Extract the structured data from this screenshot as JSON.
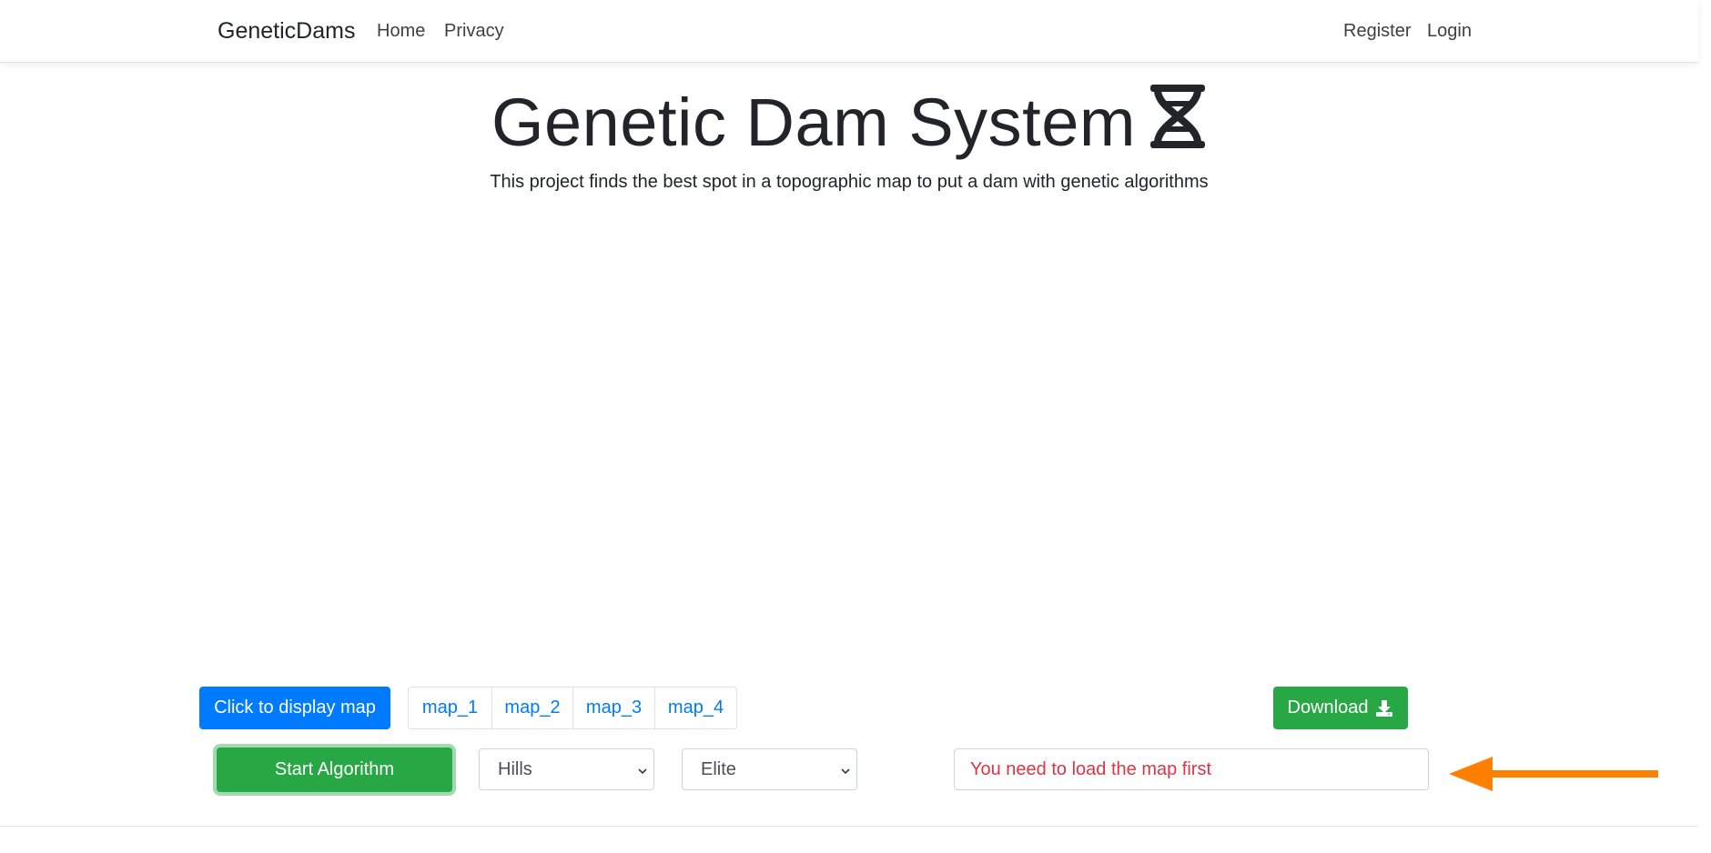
{
  "navbar": {
    "brand": "GeneticDams",
    "links": [
      "Home",
      "Privacy"
    ],
    "right_links": [
      "Register",
      "Login"
    ]
  },
  "hero": {
    "title": "Genetic Dam System",
    "title_icon": "dna-icon",
    "subtitle": "This project finds the best spot in a topographic map to put a dam with genetic algorithms"
  },
  "controls": {
    "display_map_label": "Click to display map",
    "maps": [
      "map_1",
      "map_2",
      "map_3",
      "map_4"
    ],
    "download_label": "Download",
    "download_icon": "download-icon",
    "start_label": "Start Algorithm",
    "terrain_select": "Hills",
    "selection_select": "Elite",
    "message": "You need to load the map first"
  },
  "annotation": {
    "arrow_icon": "arrow-left-icon",
    "arrow_color": "#ff7f00"
  },
  "colors": {
    "primary": "#007bff",
    "success": "#28a745",
    "danger": "#dc3545"
  }
}
